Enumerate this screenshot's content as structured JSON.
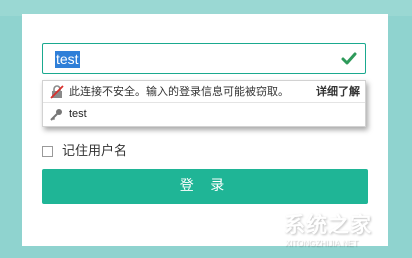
{
  "login": {
    "username_value": "test",
    "autofill": {
      "warning_text": "此连接不安全。输入的登录信息可能被窃取。",
      "learn_more": "详细了解",
      "suggestion": "test"
    },
    "remember_label": "记住用户名",
    "login_button": "登 录"
  },
  "watermark": {
    "text_cn": "系统之家",
    "text_en": "XITONGZHIJIA.NET"
  },
  "colors": {
    "background": "#8fd3cf",
    "accent": "#1fb596",
    "selection": "#2f7fd8"
  }
}
